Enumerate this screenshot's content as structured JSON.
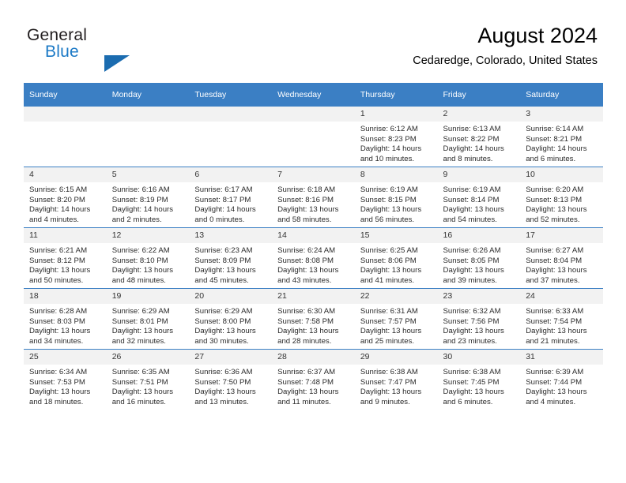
{
  "brand": {
    "name_part1": "General",
    "name_part2": "Blue",
    "triangle_color": "#1b6cb0",
    "blue_color": "#1b79c6"
  },
  "header": {
    "month_title": "August 2024",
    "location": "Cedaredge, Colorado, United States",
    "header_bg": "#3b7fc4"
  },
  "weekday_headers": [
    "Sunday",
    "Monday",
    "Tuesday",
    "Wednesday",
    "Thursday",
    "Friday",
    "Saturday"
  ],
  "labels": {
    "sunrise_prefix": "Sunrise:",
    "sunset_prefix": "Sunset:",
    "daylight_prefix": "Daylight:"
  },
  "weeks": [
    [
      {
        "empty": true
      },
      {
        "empty": true
      },
      {
        "empty": true
      },
      {
        "empty": true
      },
      {
        "day": "1",
        "sunrise": "Sunrise: 6:12 AM",
        "sunset": "Sunset: 8:23 PM",
        "daylight": "Daylight: 14 hours and 10 minutes."
      },
      {
        "day": "2",
        "sunrise": "Sunrise: 6:13 AM",
        "sunset": "Sunset: 8:22 PM",
        "daylight": "Daylight: 14 hours and 8 minutes."
      },
      {
        "day": "3",
        "sunrise": "Sunrise: 6:14 AM",
        "sunset": "Sunset: 8:21 PM",
        "daylight": "Daylight: 14 hours and 6 minutes."
      }
    ],
    [
      {
        "day": "4",
        "sunrise": "Sunrise: 6:15 AM",
        "sunset": "Sunset: 8:20 PM",
        "daylight": "Daylight: 14 hours and 4 minutes."
      },
      {
        "day": "5",
        "sunrise": "Sunrise: 6:16 AM",
        "sunset": "Sunset: 8:19 PM",
        "daylight": "Daylight: 14 hours and 2 minutes."
      },
      {
        "day": "6",
        "sunrise": "Sunrise: 6:17 AM",
        "sunset": "Sunset: 8:17 PM",
        "daylight": "Daylight: 14 hours and 0 minutes."
      },
      {
        "day": "7",
        "sunrise": "Sunrise: 6:18 AM",
        "sunset": "Sunset: 8:16 PM",
        "daylight": "Daylight: 13 hours and 58 minutes."
      },
      {
        "day": "8",
        "sunrise": "Sunrise: 6:19 AM",
        "sunset": "Sunset: 8:15 PM",
        "daylight": "Daylight: 13 hours and 56 minutes."
      },
      {
        "day": "9",
        "sunrise": "Sunrise: 6:19 AM",
        "sunset": "Sunset: 8:14 PM",
        "daylight": "Daylight: 13 hours and 54 minutes."
      },
      {
        "day": "10",
        "sunrise": "Sunrise: 6:20 AM",
        "sunset": "Sunset: 8:13 PM",
        "daylight": "Daylight: 13 hours and 52 minutes."
      }
    ],
    [
      {
        "day": "11",
        "sunrise": "Sunrise: 6:21 AM",
        "sunset": "Sunset: 8:12 PM",
        "daylight": "Daylight: 13 hours and 50 minutes."
      },
      {
        "day": "12",
        "sunrise": "Sunrise: 6:22 AM",
        "sunset": "Sunset: 8:10 PM",
        "daylight": "Daylight: 13 hours and 48 minutes."
      },
      {
        "day": "13",
        "sunrise": "Sunrise: 6:23 AM",
        "sunset": "Sunset: 8:09 PM",
        "daylight": "Daylight: 13 hours and 45 minutes."
      },
      {
        "day": "14",
        "sunrise": "Sunrise: 6:24 AM",
        "sunset": "Sunset: 8:08 PM",
        "daylight": "Daylight: 13 hours and 43 minutes."
      },
      {
        "day": "15",
        "sunrise": "Sunrise: 6:25 AM",
        "sunset": "Sunset: 8:06 PM",
        "daylight": "Daylight: 13 hours and 41 minutes."
      },
      {
        "day": "16",
        "sunrise": "Sunrise: 6:26 AM",
        "sunset": "Sunset: 8:05 PM",
        "daylight": "Daylight: 13 hours and 39 minutes."
      },
      {
        "day": "17",
        "sunrise": "Sunrise: 6:27 AM",
        "sunset": "Sunset: 8:04 PM",
        "daylight": "Daylight: 13 hours and 37 minutes."
      }
    ],
    [
      {
        "day": "18",
        "sunrise": "Sunrise: 6:28 AM",
        "sunset": "Sunset: 8:03 PM",
        "daylight": "Daylight: 13 hours and 34 minutes."
      },
      {
        "day": "19",
        "sunrise": "Sunrise: 6:29 AM",
        "sunset": "Sunset: 8:01 PM",
        "daylight": "Daylight: 13 hours and 32 minutes."
      },
      {
        "day": "20",
        "sunrise": "Sunrise: 6:29 AM",
        "sunset": "Sunset: 8:00 PM",
        "daylight": "Daylight: 13 hours and 30 minutes."
      },
      {
        "day": "21",
        "sunrise": "Sunrise: 6:30 AM",
        "sunset": "Sunset: 7:58 PM",
        "daylight": "Daylight: 13 hours and 28 minutes."
      },
      {
        "day": "22",
        "sunrise": "Sunrise: 6:31 AM",
        "sunset": "Sunset: 7:57 PM",
        "daylight": "Daylight: 13 hours and 25 minutes."
      },
      {
        "day": "23",
        "sunrise": "Sunrise: 6:32 AM",
        "sunset": "Sunset: 7:56 PM",
        "daylight": "Daylight: 13 hours and 23 minutes."
      },
      {
        "day": "24",
        "sunrise": "Sunrise: 6:33 AM",
        "sunset": "Sunset: 7:54 PM",
        "daylight": "Daylight: 13 hours and 21 minutes."
      }
    ],
    [
      {
        "day": "25",
        "sunrise": "Sunrise: 6:34 AM",
        "sunset": "Sunset: 7:53 PM",
        "daylight": "Daylight: 13 hours and 18 minutes."
      },
      {
        "day": "26",
        "sunrise": "Sunrise: 6:35 AM",
        "sunset": "Sunset: 7:51 PM",
        "daylight": "Daylight: 13 hours and 16 minutes."
      },
      {
        "day": "27",
        "sunrise": "Sunrise: 6:36 AM",
        "sunset": "Sunset: 7:50 PM",
        "daylight": "Daylight: 13 hours and 13 minutes."
      },
      {
        "day": "28",
        "sunrise": "Sunrise: 6:37 AM",
        "sunset": "Sunset: 7:48 PM",
        "daylight": "Daylight: 13 hours and 11 minutes."
      },
      {
        "day": "29",
        "sunrise": "Sunrise: 6:38 AM",
        "sunset": "Sunset: 7:47 PM",
        "daylight": "Daylight: 13 hours and 9 minutes."
      },
      {
        "day": "30",
        "sunrise": "Sunrise: 6:38 AM",
        "sunset": "Sunset: 7:45 PM",
        "daylight": "Daylight: 13 hours and 6 minutes."
      },
      {
        "day": "31",
        "sunrise": "Sunrise: 6:39 AM",
        "sunset": "Sunset: 7:44 PM",
        "daylight": "Daylight: 13 hours and 4 minutes."
      }
    ]
  ]
}
